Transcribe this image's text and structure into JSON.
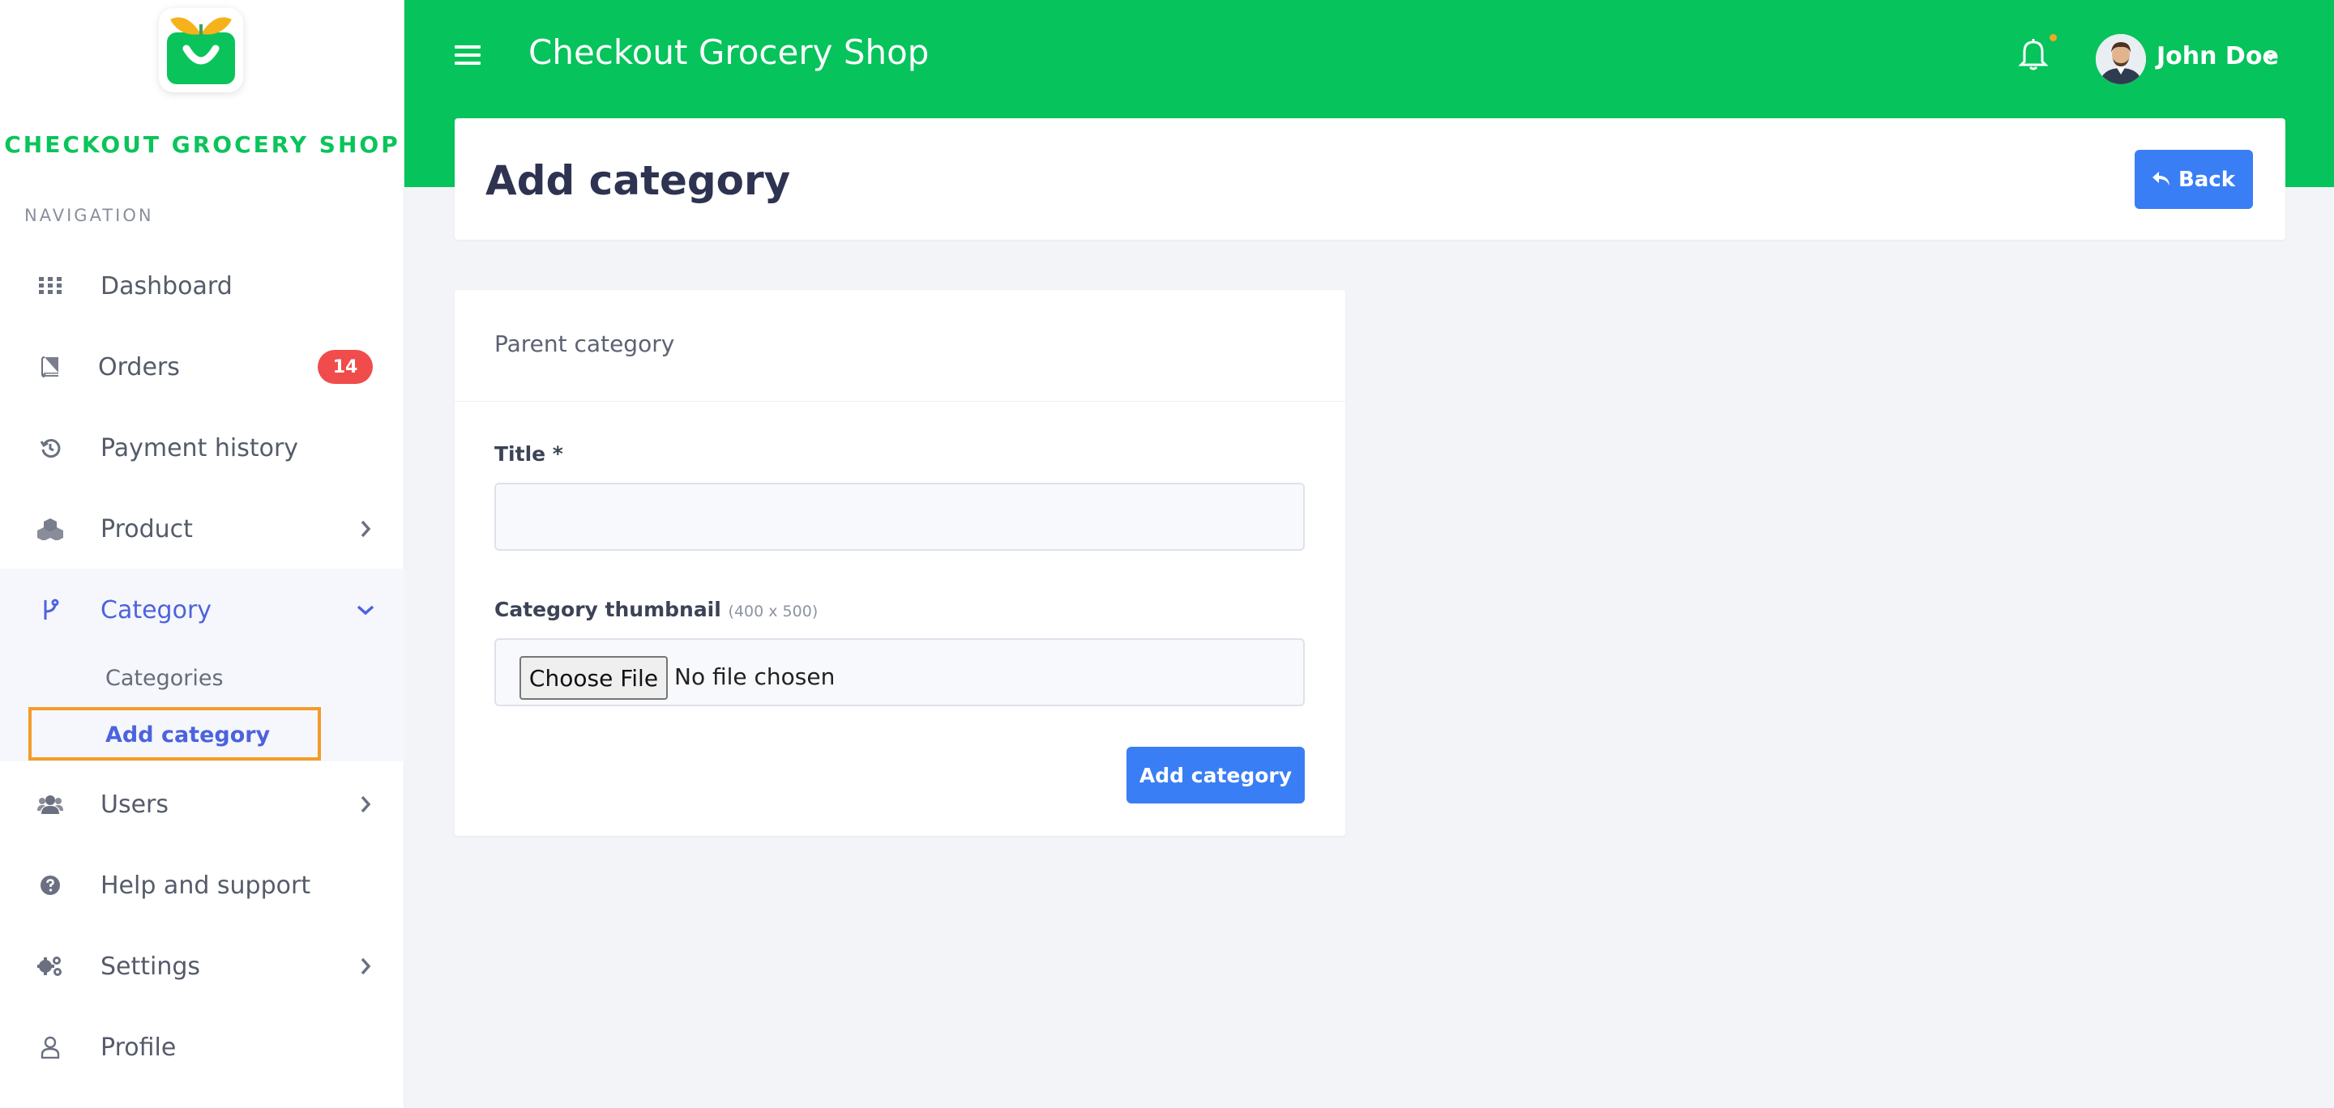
{
  "brand": {
    "name": "CHECKOUT GROCERY SHOP",
    "logo_icon": "shopping-bag-logo",
    "colors": {
      "primary_green": "#06c35b",
      "accent_blue": "#3a7ef5",
      "active_nav": "#4c63de",
      "badge_red": "#f04c4c",
      "highlight_orange": "#f39c2a"
    }
  },
  "sidebar": {
    "heading": "NAVIGATION",
    "items": [
      {
        "label": "Dashboard",
        "icon": "grid-icon"
      },
      {
        "label": "Orders",
        "icon": "book-icon",
        "badge": "14"
      },
      {
        "label": "Payment history",
        "icon": "history-icon"
      },
      {
        "label": "Product",
        "icon": "cubes-icon"
      },
      {
        "label": "Category",
        "icon": "branch-icon"
      },
      {
        "label": "Users",
        "icon": "users-icon"
      },
      {
        "label": "Help and support",
        "icon": "question-circle-icon"
      },
      {
        "label": "Settings",
        "icon": "gears-icon"
      },
      {
        "label": "Profile",
        "icon": "user-icon"
      }
    ],
    "category_subitems": [
      {
        "label": "Categories"
      },
      {
        "label": "Add category"
      }
    ]
  },
  "header": {
    "app_title": "Checkout Grocery Shop",
    "user_name": "John Doe"
  },
  "page": {
    "title": "Add category",
    "back_label": "Back"
  },
  "form": {
    "card_header": "Parent category",
    "title_label": "Title *",
    "title_value": "",
    "thumbnail_label": "Category thumbnail",
    "thumbnail_hint": "(400 x 500)",
    "choose_file_label": "Choose File",
    "no_file_text": "No file chosen",
    "submit_label": "Add category"
  }
}
